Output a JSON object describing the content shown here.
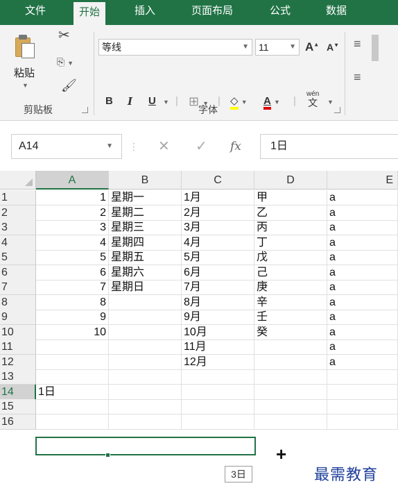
{
  "ribbon_tabs": [
    "文件",
    "开始",
    "插入",
    "页面布局",
    "公式",
    "数据"
  ],
  "clipboard": {
    "paste_label": "粘贴",
    "group_label": "剪贴板"
  },
  "font": {
    "name": "等线",
    "size": "11",
    "grow_label": "A",
    "shrink_label": "A",
    "bold": "B",
    "italic": "I",
    "underline": "U",
    "font_color_label": "A",
    "phonetic_label": "wén",
    "phonetic_char": "文",
    "group_label": "字体",
    "colors": {
      "highlight": "#ffff00",
      "font": "#e00000"
    }
  },
  "formula_bar": {
    "name_box": "A14",
    "content": "1日"
  },
  "columns": [
    "A",
    "B",
    "C",
    "D",
    "E"
  ],
  "rows": [
    {
      "num": "1",
      "a": "1",
      "b": "星期一",
      "c": "1月",
      "d": "甲",
      "e": "a"
    },
    {
      "num": "2",
      "a": "2",
      "b": "星期二",
      "c": "2月",
      "d": "乙",
      "e": "a"
    },
    {
      "num": "3",
      "a": "3",
      "b": "星期三",
      "c": "3月",
      "d": "丙",
      "e": "a"
    },
    {
      "num": "4",
      "a": "4",
      "b": "星期四",
      "c": "4月",
      "d": "丁",
      "e": "a"
    },
    {
      "num": "5",
      "a": "5",
      "b": "星期五",
      "c": "5月",
      "d": "戊",
      "e": "a"
    },
    {
      "num": "6",
      "a": "6",
      "b": "星期六",
      "c": "6月",
      "d": "己",
      "e": "a"
    },
    {
      "num": "7",
      "a": "7",
      "b": "星期日",
      "c": "7月",
      "d": "庚",
      "e": "a"
    },
    {
      "num": "8",
      "a": "8",
      "b": "",
      "c": "8月",
      "d": "辛",
      "e": "a"
    },
    {
      "num": "9",
      "a": "9",
      "b": "",
      "c": "9月",
      "d": "壬",
      "e": "a"
    },
    {
      "num": "10",
      "a": "10",
      "b": "",
      "c": "10月",
      "d": "癸",
      "e": "a"
    },
    {
      "num": "11",
      "a": "",
      "b": "",
      "c": "11月",
      "d": "",
      "e": "a"
    },
    {
      "num": "12",
      "a": "",
      "b": "",
      "c": "12月",
      "d": "",
      "e": "a"
    },
    {
      "num": "13",
      "a": "",
      "b": "",
      "c": "",
      "d": "",
      "e": ""
    },
    {
      "num": "14",
      "a": "1日",
      "b": "",
      "c": "",
      "d": "",
      "e": ""
    },
    {
      "num": "15",
      "a": "",
      "b": "",
      "c": "",
      "d": "",
      "e": ""
    },
    {
      "num": "16",
      "a": "",
      "b": "",
      "c": "",
      "d": "",
      "e": ""
    }
  ],
  "fill_tooltip": "3日",
  "watermark": "最需教育",
  "accent_color": "#217346"
}
